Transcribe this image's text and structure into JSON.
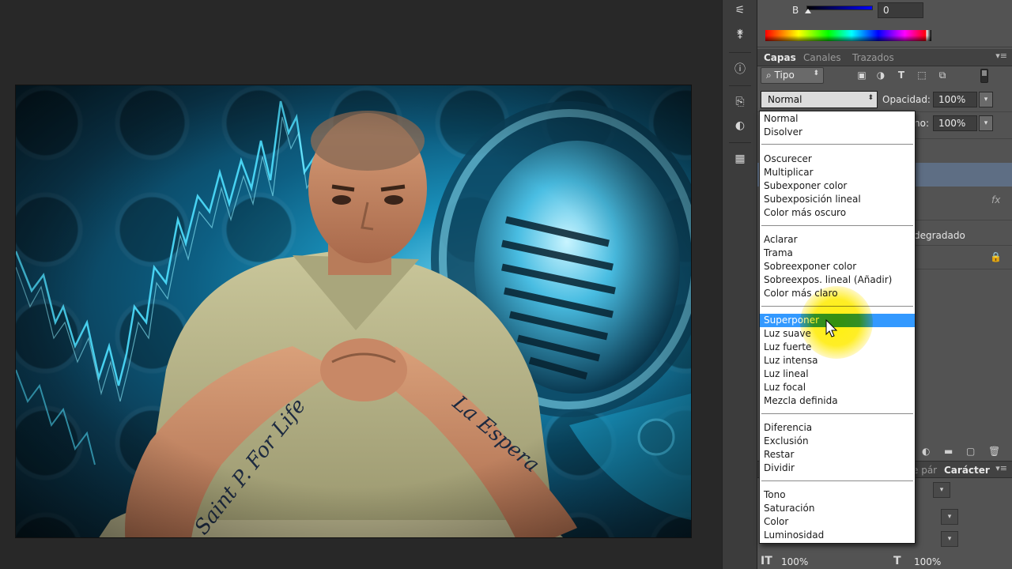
{
  "color_panel": {
    "channel_label": "B",
    "channel_value": "0"
  },
  "layers_panel": {
    "tabs": [
      "Capas",
      "Canales",
      "Trazados"
    ],
    "filter_label": "Tipo",
    "blend_mode": "Normal",
    "opacity_label": "Opacidad:",
    "opacity_value": "100%",
    "fill_label": "no:",
    "fill_value": "100%",
    "fx_label": "fx",
    "layer_fragment": "degradado"
  },
  "bottom_panel": {
    "tabs": [
      "e pár",
      "Carácter"
    ],
    "scale_vertical": "100%",
    "scale_horizontal": "100%"
  },
  "blend_menu": {
    "selected": "Superponer",
    "groups": [
      [
        "Normal",
        "Disolver"
      ],
      [
        "Oscurecer",
        "Multiplicar",
        "Subexponer color",
        "Subexposición lineal",
        "Color más oscuro"
      ],
      [
        "Aclarar",
        "Trama",
        "Sobreexponer color",
        "Sobreexpos. lineal (Añadir)",
        "Color más claro"
      ],
      [
        "Superponer",
        "Luz suave",
        "Luz fuerte",
        "Luz intensa",
        "Luz lineal",
        "Luz focal",
        "Mezcla definida"
      ],
      [
        "Diferencia",
        "Exclusión",
        "Restar",
        "Dividir"
      ],
      [
        "Tono",
        "Saturación",
        "Color",
        "Luminosidad"
      ]
    ]
  },
  "artwork": {
    "tattoo_left": "Saint P. For Life",
    "tattoo_right": "La Espera"
  },
  "colors": {
    "panel_bg": "#535353",
    "menu_selected": "#3399ff",
    "artwork_cyan": "#1b95c0",
    "cursor_highlight": "#ffe600"
  }
}
